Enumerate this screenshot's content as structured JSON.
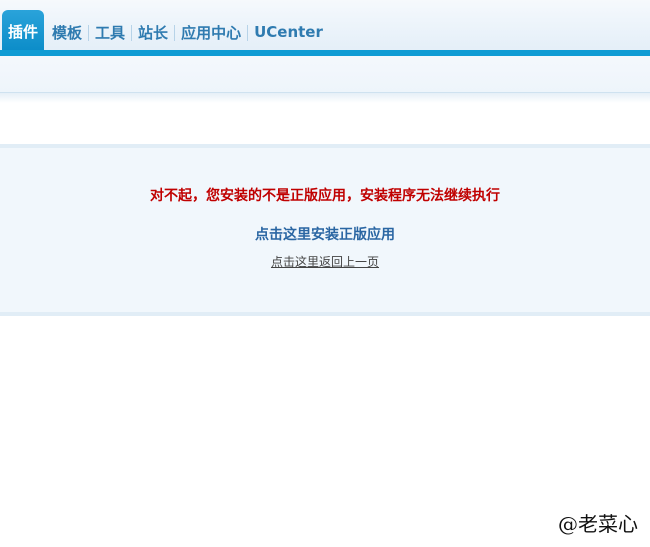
{
  "nav": {
    "tabs": [
      {
        "label": "插件",
        "active": true
      },
      {
        "label": "模板",
        "active": false
      },
      {
        "label": "工具",
        "active": false
      },
      {
        "label": "站长",
        "active": false
      },
      {
        "label": "应用中心",
        "active": false
      },
      {
        "label": "UCenter",
        "active": false
      }
    ]
  },
  "message": {
    "error_text": "对不起，您安装的不是正版应用，安装程序无法继续执行",
    "install_genuine_link": "点击这里安装正版应用",
    "go_back_link": "点击这里返回上一页"
  },
  "watermark": {
    "text": "@老菜心"
  },
  "colors": {
    "nav_accent": "#109cd4",
    "tab_text": "#2f7bb0",
    "error_text": "#c00000",
    "link_text": "#2a66a3"
  }
}
